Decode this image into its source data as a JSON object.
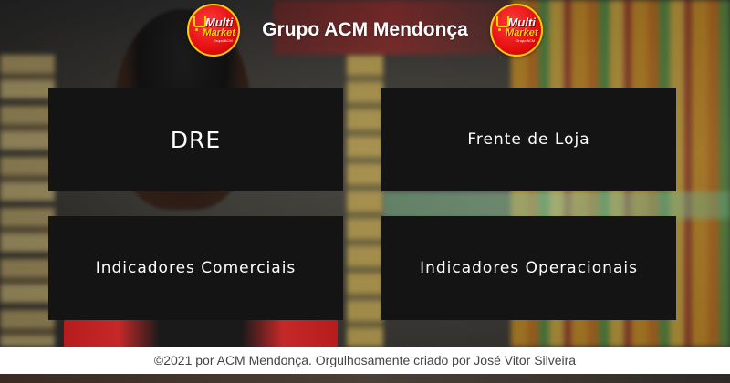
{
  "header": {
    "title": "Grupo ACM Mendonça",
    "logo": {
      "line1": "Multi",
      "line2": "Market",
      "line3": "Grupo ACM"
    }
  },
  "tiles": [
    {
      "label": "DRE"
    },
    {
      "label": "Frente de Loja"
    },
    {
      "label": "Indicadores Comerciais"
    },
    {
      "label": "Indicadores Operacionais"
    }
  ],
  "footer": {
    "text": "©2021 por ACM Mendonça. Orgulhosamente criado por José Vitor Silveira"
  },
  "colors": {
    "tile_bg": "#141414",
    "logo_red": "#e41010",
    "logo_yellow": "#ffd400",
    "footer_bg": "#ffffff"
  }
}
